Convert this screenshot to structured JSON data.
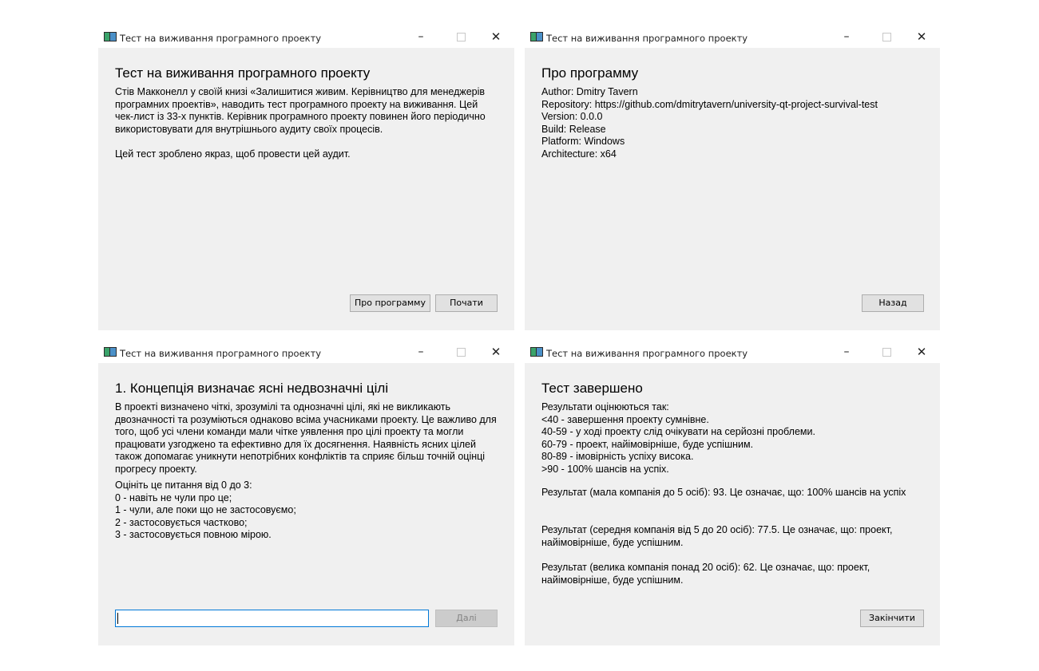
{
  "window_title": "Тест на виживання програмного проекту",
  "controls": {
    "minimize": "–",
    "close": "✕"
  },
  "icons": {
    "app": "app-window-icon",
    "minimize": "minimize-icon",
    "maximize": "maximize-icon",
    "close": "close-icon"
  },
  "colors": {
    "client_bg": "#f0f0f0",
    "focus_border": "#0078d7",
    "button_bg": "#e1e1e1"
  },
  "intro": {
    "heading": "Тест на виживання програмного проекту",
    "text": "Стів Макконелл у своїй книзі «Залишитися живим. Керівництво для менеджерів програмних проектів», наводить тест програмного проекту на виживання. Цей чек-лист із 33-х пунктів. Керівник програмного проекту повинен його періодично використовувати для внутрішнього аудиту своїх процесів.\n\nЦей тест зроблено якраз, щоб провести цей аудит.",
    "about_button": "Про программу",
    "start_button": "Почати"
  },
  "about": {
    "heading": "Про программу",
    "text": "Author: Dmitry Tavern\nRepository: https://github.com/dmitrytavern/university-qt-project-survival-test\nVersion: 0.0.0\nBuild: Release\nPlatform: Windows\nArchitecture: x64",
    "back_button": "Назад"
  },
  "question": {
    "heading": "1. Концепція визначає ясні недвозначні цілі",
    "description": "В проекті визначено чіткі, зрозумілі та однозначні цілі, які не викликають двозначності та розуміються однаково всіма учасниками проекту. Це важливо для того, щоб усі члени команди мали чітке уявлення про цілі проекту та могли працювати узгоджено та ефективно для їх досягнення. Наявність ясних цілей також допомагає уникнути непотрібних конфліктів та сприяє більш точній оцінці прогресу проекту.",
    "scale": "Оцініть це питання від 0 до 3:\n  0 - навіть не чули про це;\n  1 - чули, але поки що не застосовуємо;\n  2 - застосовується частково;\n  3 - застосовується повною мірою.",
    "answer_value": "",
    "next_button": "Далі"
  },
  "result": {
    "heading": "Тест завершено",
    "scale": "Результати оцінюються так:\n  <40 - завершення проекту сумнівне.\n  40-59 - у ході проекту слід очікувати на серйозні проблеми.\n  60-79 - проект, найімовірніше, буде успішним.\n  80-89 - імовірність успіху висока.\n  >90 - 100% шансів на успіх.",
    "small": "Результат (мала компанія до 5 осіб): 93. Це означає, що: 100% шансів на успіх",
    "medium": "Результат (середня компанія від 5 до 20 осіб): 77.5. Це означає, що: проект, найімовірніше, буде успішним.",
    "large": "Результат (велика компанія понад 20 осіб): 62. Це означає, що: проект, найімовірніше, буде успішним.",
    "finish_button": "Закінчити"
  }
}
